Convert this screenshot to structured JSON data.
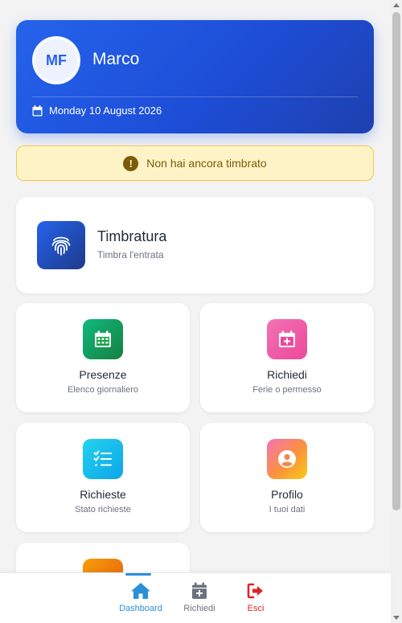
{
  "profile": {
    "initials": "MF",
    "name": "Marco",
    "date": "Monday 10 August 2026"
  },
  "alert": {
    "icon": "exclamation-icon",
    "text": "Non hai ancora timbrato"
  },
  "clock_in_tile": {
    "icon": "fingerprint-icon",
    "title": "Timbratura",
    "subtitle": "Timbra l'entrata"
  },
  "tiles": [
    {
      "icon": "calendar-grid-icon",
      "title": "Presenze",
      "subtitle": "Elenco giornaliero"
    },
    {
      "icon": "calendar-plus-icon",
      "title": "Richiedi",
      "subtitle": "Ferie o permesso"
    },
    {
      "icon": "list-check-icon",
      "title": "Richieste",
      "subtitle": "Stato richieste"
    },
    {
      "icon": "user-circle-icon",
      "title": "Profilo",
      "subtitle": "I tuoi dati"
    }
  ],
  "bottom_nav": [
    {
      "icon": "home-icon",
      "label": "Dashboard",
      "active": true
    },
    {
      "icon": "calendar-plus-icon",
      "label": "Richiedi",
      "active": false
    },
    {
      "icon": "sign-out-icon",
      "label": "Esci",
      "active": false
    }
  ],
  "colors": {
    "primary": "#2563eb",
    "alert_bg": "#fef3c7",
    "alert_text": "#7c5a07",
    "nav_active": "#2b8fd8",
    "nav_inactive": "#6b7280",
    "logout": "#dc2626"
  }
}
